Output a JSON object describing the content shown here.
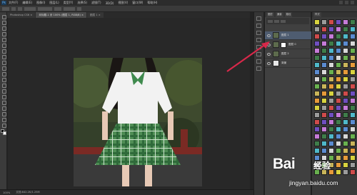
{
  "menubar": {
    "logo": "Ps",
    "items": [
      "文件(F)",
      "编辑(E)",
      "图像(I)",
      "图层(L)",
      "类型(Y)",
      "选择(S)",
      "滤镜(T)",
      "3D(D)",
      "视图(V)",
      "窗口(W)",
      "帮助(H)"
    ]
  },
  "document_tabs": [
    {
      "label": "Photoshop CS6 ×",
      "active": false
    },
    {
      "label": "未标题-1 @ 100% (图层 1, RGB/8) ×",
      "active": true
    },
    {
      "label": "图层 1 ×",
      "active": false
    }
  ],
  "status": {
    "zoom": "100%",
    "doc_info": "文档:642.2K/1.25M"
  },
  "layers_panel": {
    "tabs": [
      "图层",
      "通道",
      "路径"
    ],
    "layers": [
      {
        "name": "图层 1",
        "selected": true,
        "thumb": "photo"
      },
      {
        "name": "图层 0",
        "selected": false,
        "thumb": "mask"
      },
      {
        "name": "图层 2",
        "selected": false,
        "thumb": "photo"
      },
      {
        "name": "背景",
        "selected": false,
        "thumb": "white"
      }
    ]
  },
  "styles_panel": {
    "tab": "样式",
    "swatch_colors": [
      "#d8d33f",
      "#5b8bd0",
      "#cf4b4b",
      "#69b14f",
      "#c67bd8",
      "#e69a3a",
      "#4fb8c9",
      "#9b9b9b",
      "#d8d8d8",
      "#6f4fc0",
      "#c9b55a",
      "#3f7d4a"
    ]
  },
  "watermark": {
    "brand": "Bai",
    "brand2": "经验",
    "url": "jingyan.baidu.com"
  },
  "colors": {
    "accent_arrow": "#d8284a",
    "selected_layer": "#4e5c70"
  }
}
